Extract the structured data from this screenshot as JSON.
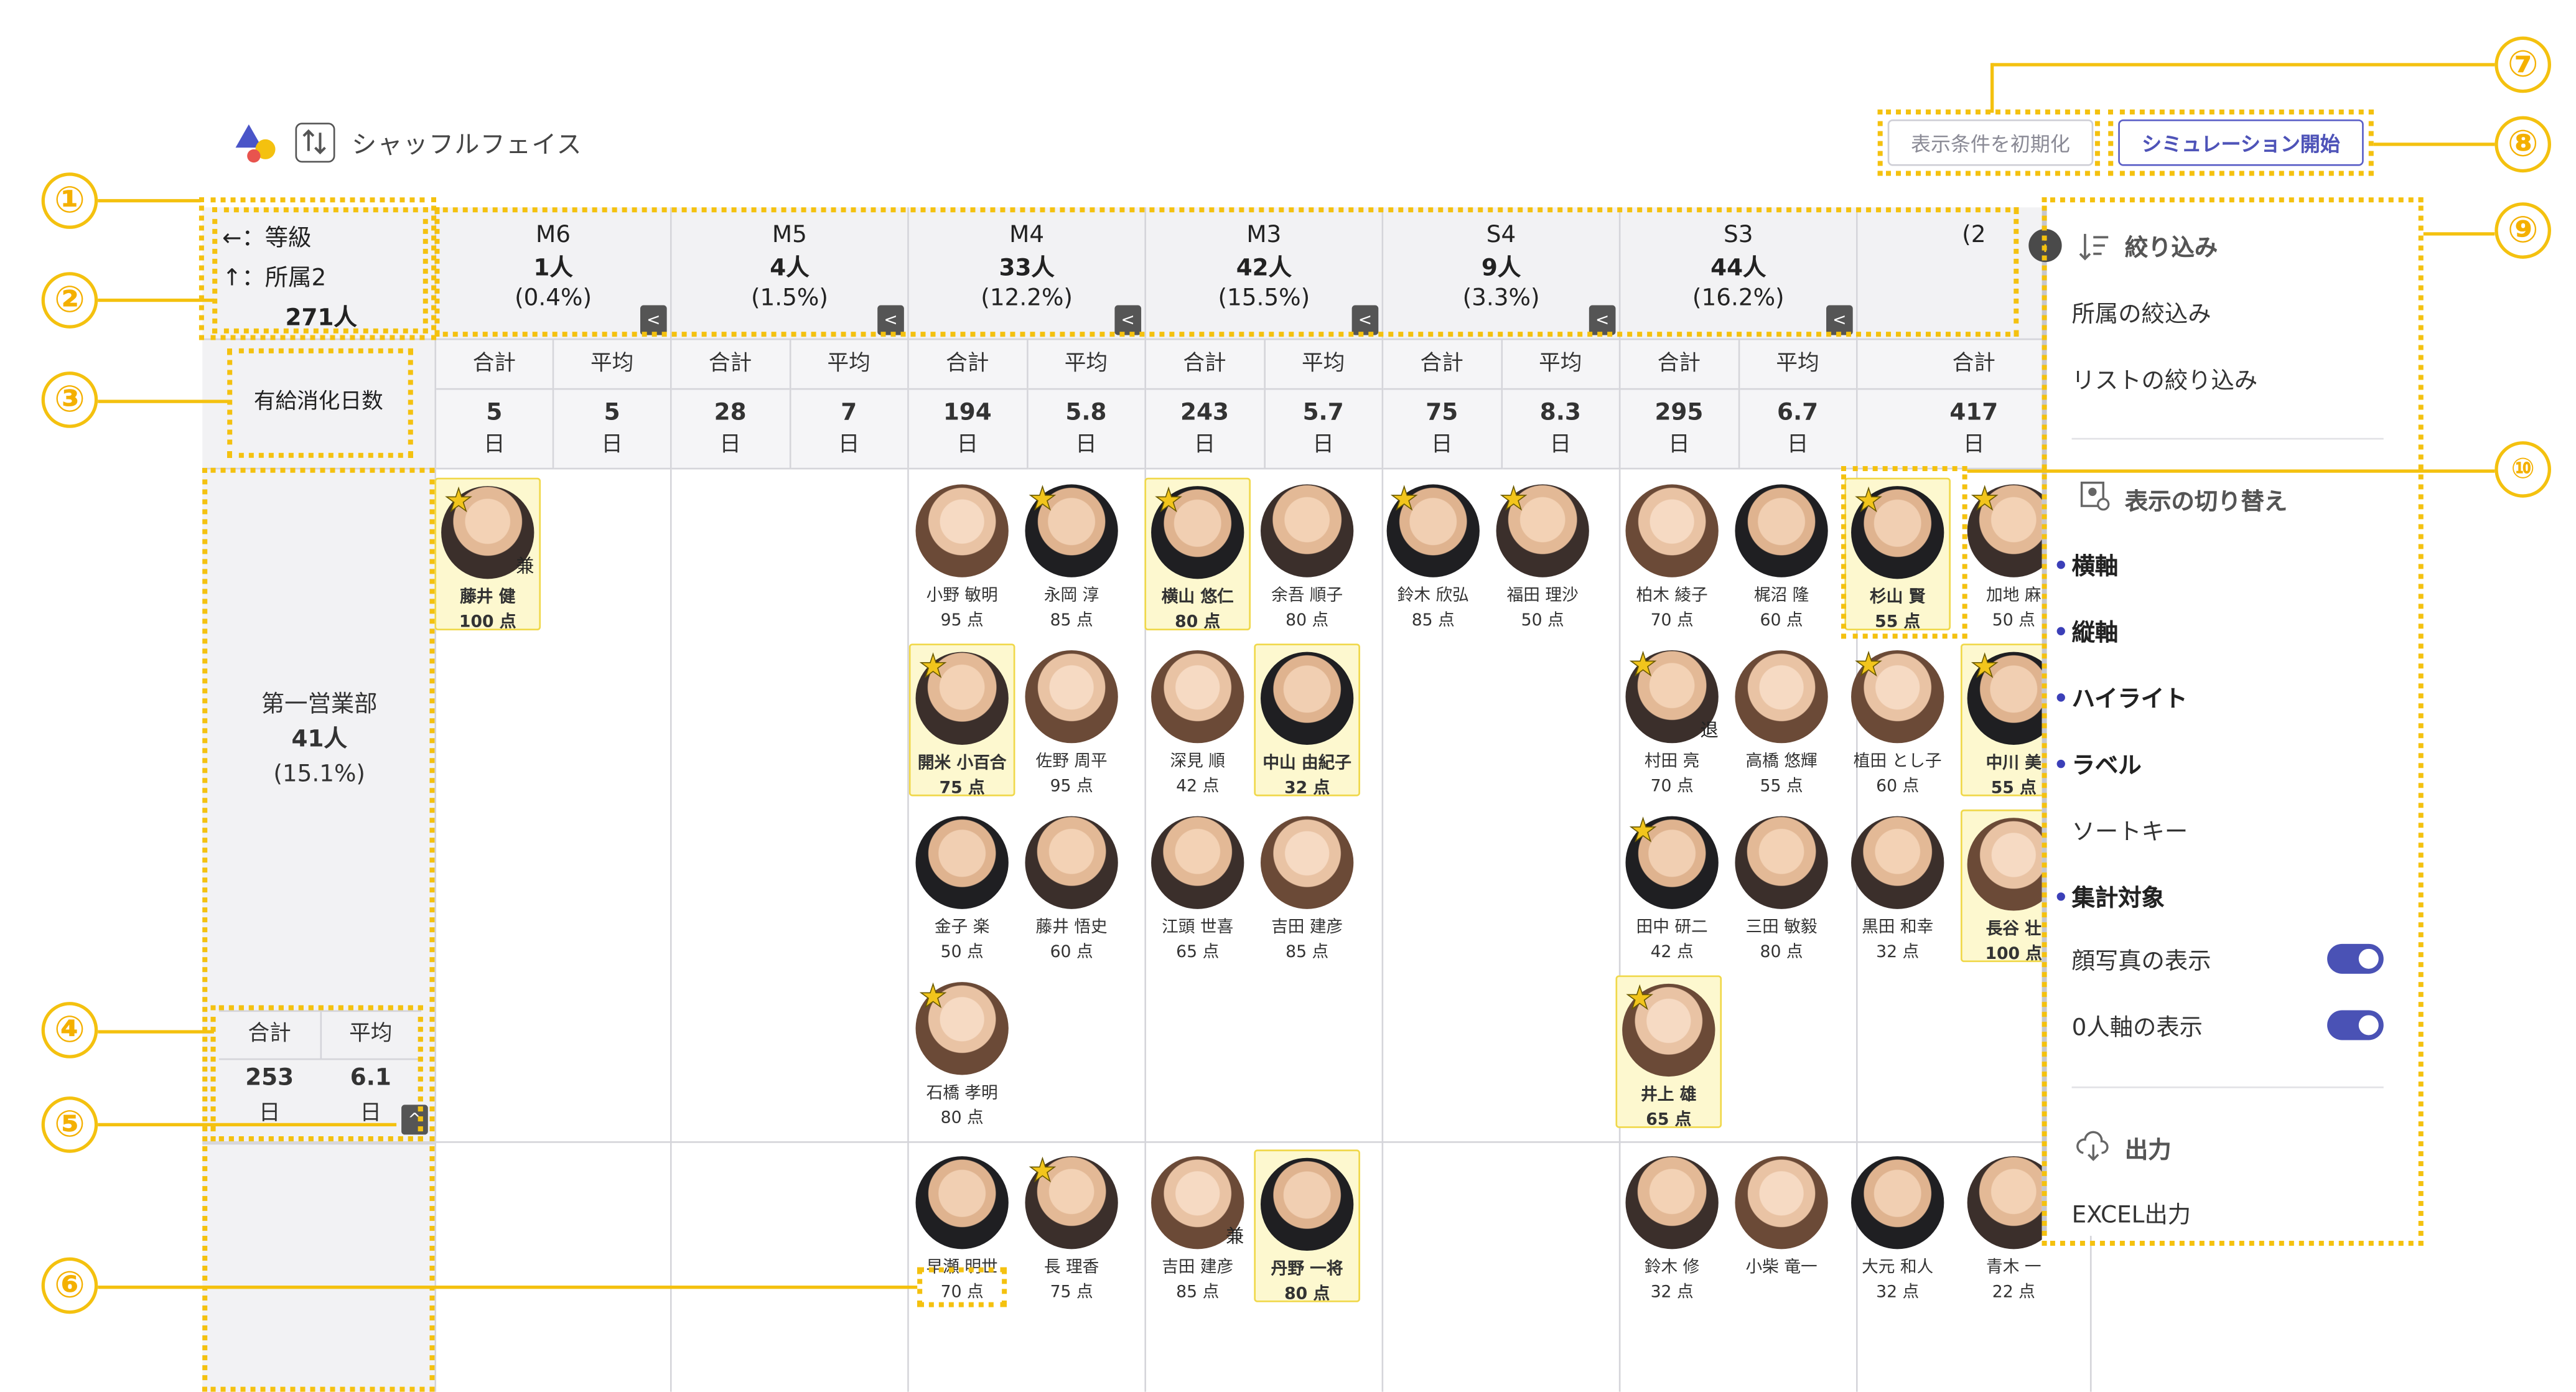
{
  "app": {
    "title": "シャッフルフェイス"
  },
  "toolbar": {
    "reset_label": "表示条件を初期化",
    "simulate_label": "シミュレーション開始"
  },
  "corner": {
    "line1": "←：等級",
    "line2": "↑：所属2",
    "count": "271人"
  },
  "grades": [
    {
      "name": "M6",
      "count": "1人",
      "pct": "(0.4%)"
    },
    {
      "name": "M5",
      "count": "4人",
      "pct": "(1.5%)"
    },
    {
      "name": "M4",
      "count": "33人",
      "pct": "(12.2%)"
    },
    {
      "name": "M3",
      "count": "42人",
      "pct": "(15.5%)"
    },
    {
      "name": "S4",
      "count": "9人",
      "pct": "(3.3%)"
    },
    {
      "name": "S3",
      "count": "44人",
      "pct": "(16.2%)"
    },
    {
      "name": "",
      "count": "",
      "pct": "(2"
    }
  ],
  "metric": {
    "label": "有給消化日数"
  },
  "stats": {
    "sum_label": "合計",
    "avg_label": "平均",
    "unit": "日",
    "cols": [
      {
        "sum": "5",
        "avg": "5"
      },
      {
        "sum": "28",
        "avg": "7"
      },
      {
        "sum": "194",
        "avg": "5.8"
      },
      {
        "sum": "243",
        "avg": "5.7"
      },
      {
        "sum": "75",
        "avg": "8.3"
      },
      {
        "sum": "295",
        "avg": "6.7"
      },
      {
        "sum": "417",
        "avg": ""
      }
    ]
  },
  "row1": {
    "dept": "第一営業部",
    "count": "41人",
    "pct": "(15.1%)",
    "sum_label": "合計",
    "avg_label": "平均",
    "sum": "253",
    "avg": "6.1",
    "unit": "日"
  },
  "people": [
    {
      "name": "藤井 健",
      "score": "100 点",
      "star": true,
      "hl": true,
      "tag": "兼"
    },
    {
      "name": "小野 敏明",
      "score": "95 点"
    },
    {
      "name": "永岡 淳",
      "score": "85 点",
      "star": true
    },
    {
      "name": "開米 小百合",
      "score": "75 点",
      "star": true,
      "hl": true
    },
    {
      "name": "佐野 周平",
      "score": "95 点"
    },
    {
      "name": "金子 楽",
      "score": "50 点"
    },
    {
      "name": "藤井 悟史",
      "score": "60 点"
    },
    {
      "name": "石橋 孝明",
      "score": "80 点",
      "star": true
    },
    {
      "name": "横山 悠仁",
      "score": "80 点",
      "star": true,
      "hl": true
    },
    {
      "name": "余吾 順子",
      "score": "80 点"
    },
    {
      "name": "深見 順",
      "score": "42 点"
    },
    {
      "name": "中山 由紀子",
      "score": "32 点",
      "hl": true
    },
    {
      "name": "江頭 世喜",
      "score": "65 点"
    },
    {
      "name": "吉田 建彦",
      "score": "85 点"
    },
    {
      "name": "鈴木 欣弘",
      "score": "85 点",
      "star": true
    },
    {
      "name": "福田 理沙",
      "score": "50 点",
      "star": true
    },
    {
      "name": "柏木 綾子",
      "score": "70 点"
    },
    {
      "name": "梶沼 隆",
      "score": "60 点"
    },
    {
      "name": "村田 亮",
      "score": "70 点",
      "star": true,
      "tag": "退"
    },
    {
      "name": "高橋 悠輝",
      "score": "55 点"
    },
    {
      "name": "田中 研二",
      "score": "42 点",
      "star": true
    },
    {
      "name": "三田 敏毅",
      "score": "80 点"
    },
    {
      "name": "井上 雄",
      "score": "65 点",
      "star": true,
      "hl": true
    },
    {
      "name": "杉山 賢",
      "score": "55 点",
      "star": true,
      "hl": true
    },
    {
      "name": "加地 麻",
      "score": "50 点",
      "star": true
    },
    {
      "name": "植田 とし子",
      "score": "60 点",
      "star": true
    },
    {
      "name": "中川 美",
      "score": "55 点",
      "star": true,
      "hl": true
    },
    {
      "name": "黒田 和幸",
      "score": "32 点"
    },
    {
      "name": "長谷 壮",
      "score": "100 点",
      "hl": true
    },
    {
      "name": "早瀬 明世",
      "score": "70 点"
    },
    {
      "name": "長 理香",
      "score": "75 点",
      "star": true
    },
    {
      "name": "吉田 建彦",
      "score": "85 点",
      "tag": "兼"
    },
    {
      "name": "丹野 一将",
      "score": "80 点",
      "hl": true
    },
    {
      "name": "鈴木 修",
      "score": "32 点"
    },
    {
      "name": "小柴 竜一",
      "score": ""
    },
    {
      "name": "大元 和人",
      "score": "32 点"
    },
    {
      "name": "青木 一",
      "score": "22 点"
    }
  ],
  "panel": {
    "filter_title": "絞り込み",
    "filter_dept": "所属の絞込み",
    "filter_list": "リストの絞り込み",
    "switch_title": "表示の切り替え",
    "items": [
      "横軸",
      "縦軸",
      "ハイライト",
      "ラベル",
      "ソートキー",
      "集計対象"
    ],
    "show_photo": "顔写真の表示",
    "show_empty": "0人軸の表示",
    "output_title": "出力",
    "excel": "EXCEL出力"
  },
  "annotations": [
    "①",
    "②",
    "③",
    "④",
    "⑤",
    "⑥",
    "⑦",
    "⑧",
    "⑨",
    "⑩"
  ],
  "colors": {
    "accent": "#5b5fc7",
    "annotation": "#f4c10f",
    "highlight_bg": "#fdf8cf"
  }
}
